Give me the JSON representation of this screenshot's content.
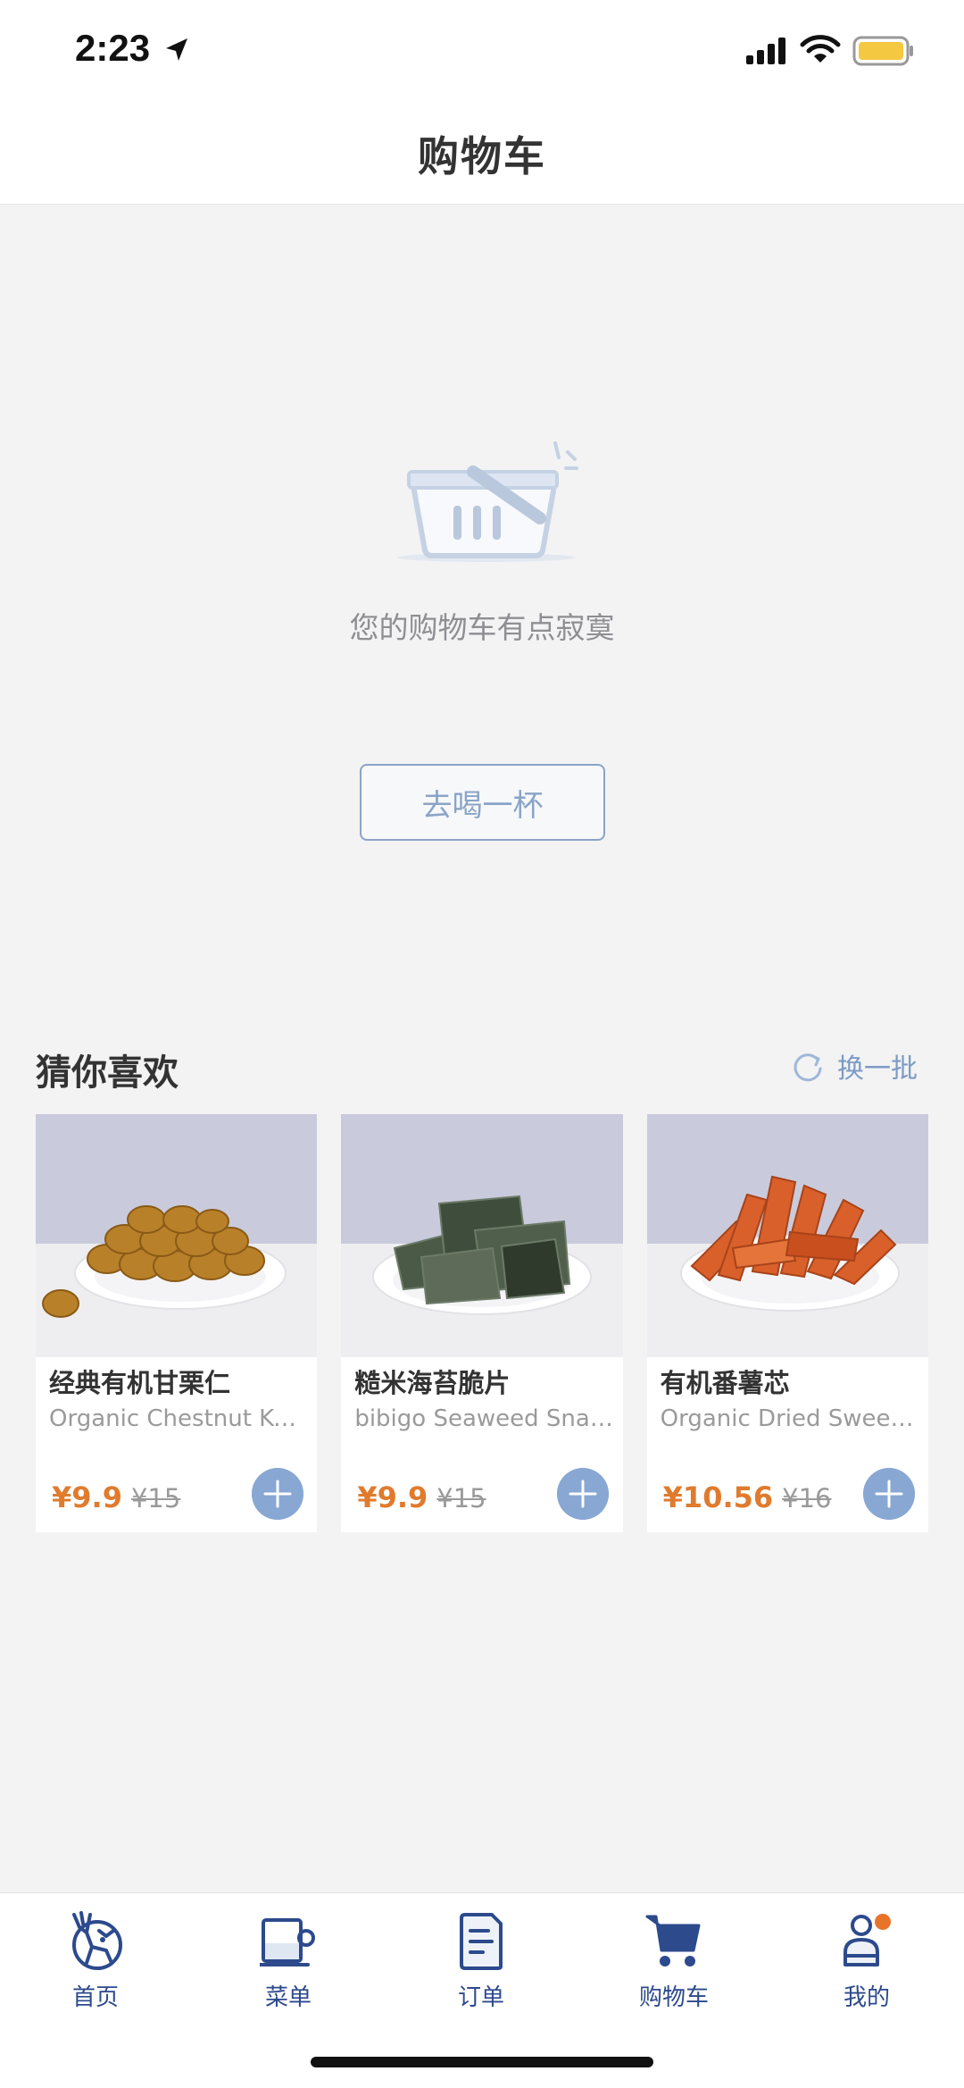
{
  "status_bar": {
    "time": "2:23"
  },
  "header": {
    "title": "购物车"
  },
  "empty_state": {
    "message": "您的购物车有点寂寞",
    "button_label": "去喝一杯"
  },
  "recommendations": {
    "title": "猜你喜欢",
    "refresh_label": "换一批",
    "products": [
      {
        "name": "经典有机甘栗仁",
        "english_name": "Organic Chestnut Ker...",
        "price": "¥9.9",
        "original_price": "¥15"
      },
      {
        "name": "糙米海苔脆片",
        "english_name": "bibigo Seaweed Snac...",
        "price": "¥9.9",
        "original_price": "¥15"
      },
      {
        "name": "有机番薯芯",
        "english_name": "Organic Dried Sweet...",
        "price": "¥10.56",
        "original_price": "¥16"
      }
    ]
  },
  "tab_bar": {
    "items": [
      {
        "label": "首页",
        "icon": "deer-logo-icon"
      },
      {
        "label": "菜单",
        "icon": "cup-icon"
      },
      {
        "label": "订单",
        "icon": "order-document-icon"
      },
      {
        "label": "购物车",
        "icon": "cart-icon"
      },
      {
        "label": "我的",
        "icon": "user-icon"
      }
    ]
  },
  "colors": {
    "accent": "#2c4a8c",
    "price": "#e07b2e",
    "button_outline": "#8aa4c6",
    "add_button": "#88a7d3",
    "notification_dot": "#e8742a"
  }
}
